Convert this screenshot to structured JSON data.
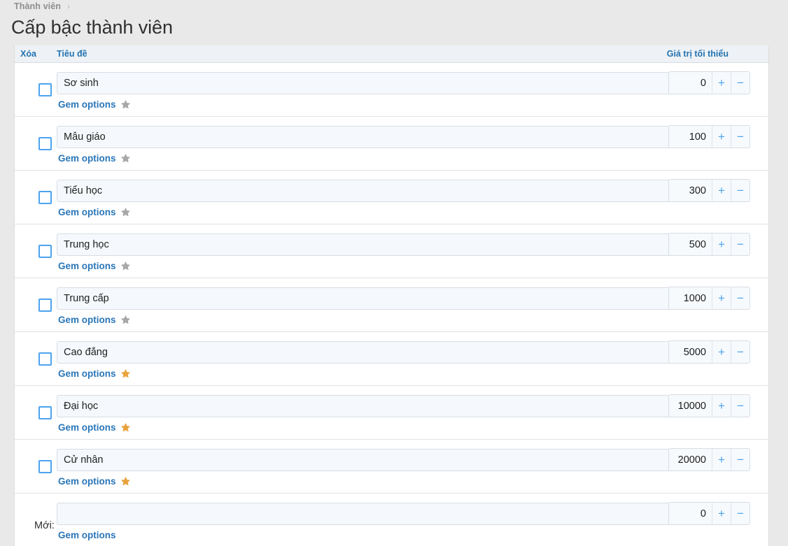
{
  "breadcrumb": {
    "crumb": "Thành viên",
    "separator": "›"
  },
  "page_title": "Cấp bậc thành viên",
  "table": {
    "headers": {
      "delete": "Xóa",
      "title": "Tiêu đề",
      "min_value": "Giá trị tối thiểu"
    },
    "stepper": {
      "increment_label": "+",
      "decrement_label": "−"
    },
    "gem_options_label": "Gem options",
    "new_row_label": "Mới:",
    "star_colors": {
      "inactive": "#a8a8a8",
      "active": "#e8a33d"
    },
    "rows": [
      {
        "title": "Sơ sinh",
        "min_value": "0",
        "gem_label": "Gem options",
        "star": "star-inactive-icon",
        "checked": false,
        "is_new": false
      },
      {
        "title": "Mẫu giáo",
        "min_value": "100",
        "gem_label": "Gem options",
        "star": "star-inactive-icon",
        "checked": false,
        "is_new": false
      },
      {
        "title": "Tiểu học",
        "min_value": "300",
        "gem_label": "Gem options",
        "star": "star-inactive-icon",
        "checked": false,
        "is_new": false
      },
      {
        "title": "Trung học",
        "min_value": "500",
        "gem_label": "Gem options",
        "star": "star-inactive-icon",
        "checked": false,
        "is_new": false
      },
      {
        "title": "Trung cấp",
        "min_value": "1000",
        "gem_label": "Gem options",
        "star": "star-inactive-icon",
        "checked": false,
        "is_new": false
      },
      {
        "title": "Cao đẳng",
        "min_value": "5000",
        "gem_label": "Gem options",
        "star": "star-active-icon",
        "checked": false,
        "is_new": false
      },
      {
        "title": "Đại học",
        "min_value": "10000",
        "gem_label": "Gem options",
        "star": "star-active-icon",
        "checked": false,
        "is_new": false
      },
      {
        "title": "Cử nhân",
        "min_value": "20000",
        "gem_label": "Gem options",
        "star": "star-active-icon",
        "checked": false,
        "is_new": false
      },
      {
        "title": "",
        "min_value": "0",
        "gem_label": "Gem options",
        "star": null,
        "checked": false,
        "is_new": true,
        "new_label": "Mới:"
      }
    ]
  }
}
